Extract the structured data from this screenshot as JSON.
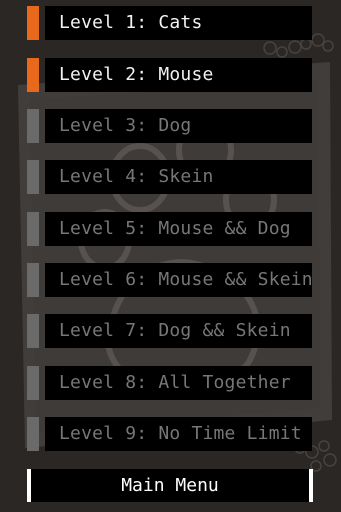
{
  "levels": [
    {
      "label": "Level 1: Cats",
      "status": "unlocked"
    },
    {
      "label": "Level 2: Mouse",
      "status": "unlocked"
    },
    {
      "label": "Level 3: Dog",
      "status": "locked"
    },
    {
      "label": "Level 4: Skein",
      "status": "locked"
    },
    {
      "label": "Level 5: Mouse && Dog",
      "status": "locked"
    },
    {
      "label": "Level 6: Mouse && Skein",
      "status": "locked"
    },
    {
      "label": "Level 7: Dog && Skein",
      "status": "locked"
    },
    {
      "label": "Level 8: All Together",
      "status": "locked"
    },
    {
      "label": "Level 9: No Time Limit",
      "status": "locked"
    }
  ],
  "main_menu": {
    "label": "Main Menu"
  },
  "colors": {
    "background": "#2b2725",
    "unlocked_indicator": "#e8691b",
    "locked_indicator": "#6a6a6a",
    "unlocked_text": "#f2f2f2",
    "locked_text": "#777777"
  },
  "decor": {
    "background_art": "paw-print-icon"
  }
}
